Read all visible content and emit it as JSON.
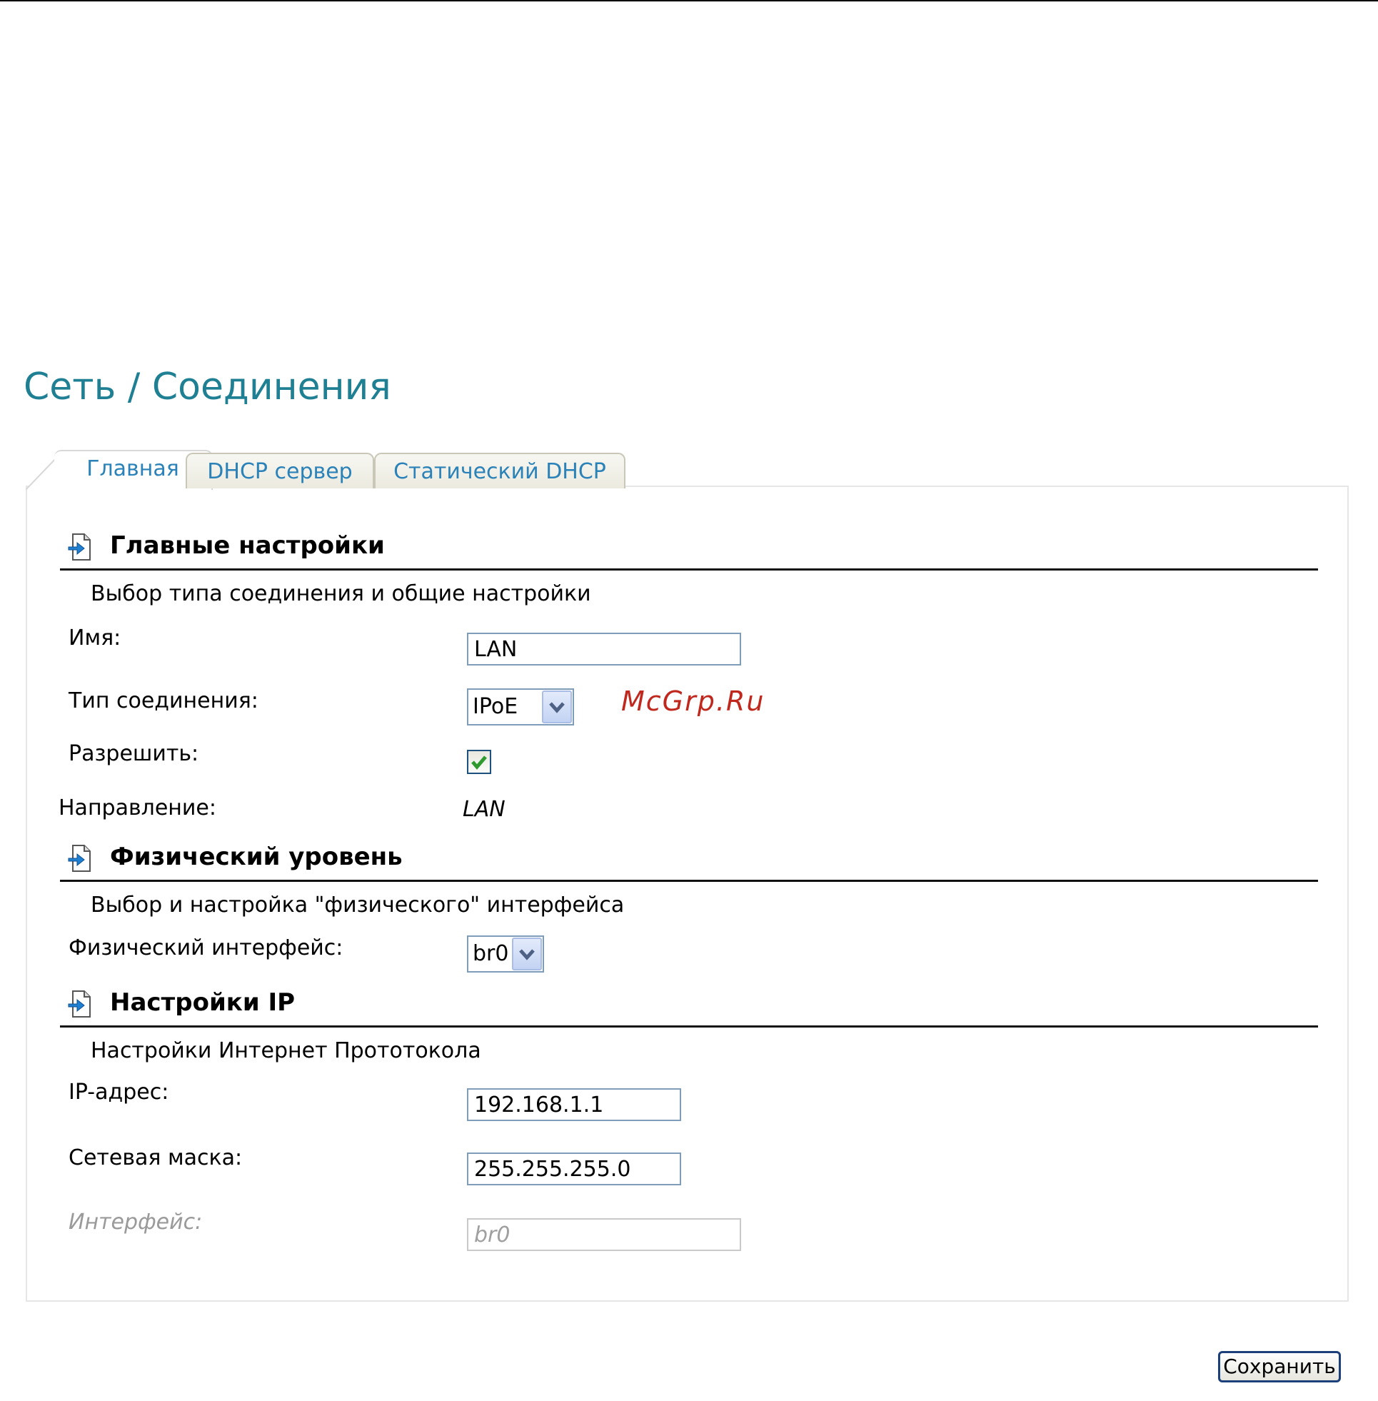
{
  "page": {
    "title": "Сеть / Соединения"
  },
  "tabs": [
    {
      "label": "Главная",
      "active": true
    },
    {
      "label": "DHCP сервер",
      "active": false
    },
    {
      "label": "Статический DHCP",
      "active": false
    }
  ],
  "main_settings": {
    "title": "Главные настройки",
    "description": "Выбор типа соединения и общие настройки",
    "name_label": "Имя:",
    "name_value": "LAN",
    "conn_type_label": "Тип соединения:",
    "conn_type_value": "IPoE",
    "enable_label": "Разрешить:",
    "enable_checked": true,
    "direction_label": "Направление:",
    "direction_value": "LAN"
  },
  "physical": {
    "title": "Физический уровень",
    "description": "Выбор и настройка \"физического\" интерфейса",
    "iface_label": "Физический интерфейс:",
    "iface_value": "br0"
  },
  "ip_settings": {
    "title": "Настройки IP",
    "description": "Настройки Интернет Прототокола",
    "ip_label": "IP-адрес:",
    "ip_value": "192.168.1.1",
    "mask_label": "Сетевая маска:",
    "mask_value": "255.255.255.0",
    "iface_label": "Интерфейс:",
    "iface_value": "br0"
  },
  "watermark": "McGrp.Ru",
  "save_label": "Сохранить",
  "colors": {
    "title": "#1f7f93",
    "tab_text": "#2a82b8",
    "checkmark": "#2e9a2e"
  },
  "icons": {
    "section": "page-arrow-icon",
    "dropdown": "chevron-down-icon",
    "checkbox": "checkmark-icon"
  }
}
